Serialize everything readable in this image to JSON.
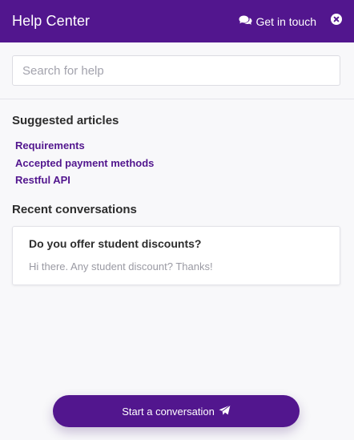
{
  "header": {
    "title": "Help Center",
    "contact_label": "Get in touch"
  },
  "search": {
    "placeholder": "Search for help",
    "value": ""
  },
  "suggested": {
    "title": "Suggested articles",
    "articles": [
      {
        "label": "Requirements"
      },
      {
        "label": "Accepted payment methods"
      },
      {
        "label": "Restful API"
      }
    ]
  },
  "recent": {
    "title": "Recent conversations",
    "conversations": [
      {
        "title": "Do you offer student discounts?",
        "preview": "Hi there. Any student discount? Thanks!"
      }
    ]
  },
  "footer": {
    "start_label": "Start a conversation"
  },
  "colors": {
    "brand": "#52168e",
    "background": "#f8f8fa",
    "muted_text": "#9a9aa3"
  },
  "icons": {
    "contact": "chat-bubbles-icon",
    "close": "close-circle-icon",
    "start": "paper-plane-icon"
  }
}
